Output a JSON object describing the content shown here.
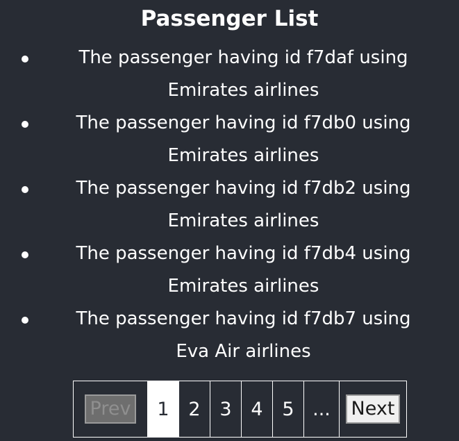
{
  "page": {
    "title": "Passenger List"
  },
  "passengers": [
    {
      "text": "The passenger having id f7daf using Emirates airlines"
    },
    {
      "text": "The passenger having id f7db0 using Emirates airlines"
    },
    {
      "text": "The passenger having id f7db2 using Emirates airlines"
    },
    {
      "text": "The passenger having id f7db4 using Emirates airlines"
    },
    {
      "text": "The passenger having id f7db7 using Eva Air airlines"
    }
  ],
  "pagination": {
    "prev_label": "Prev",
    "next_label": "Next",
    "pages": [
      "1",
      "2",
      "3",
      "4",
      "5"
    ],
    "ellipsis": "...",
    "current_page": "1"
  },
  "colors": {
    "background": "#282c34",
    "text": "#ffffff"
  }
}
